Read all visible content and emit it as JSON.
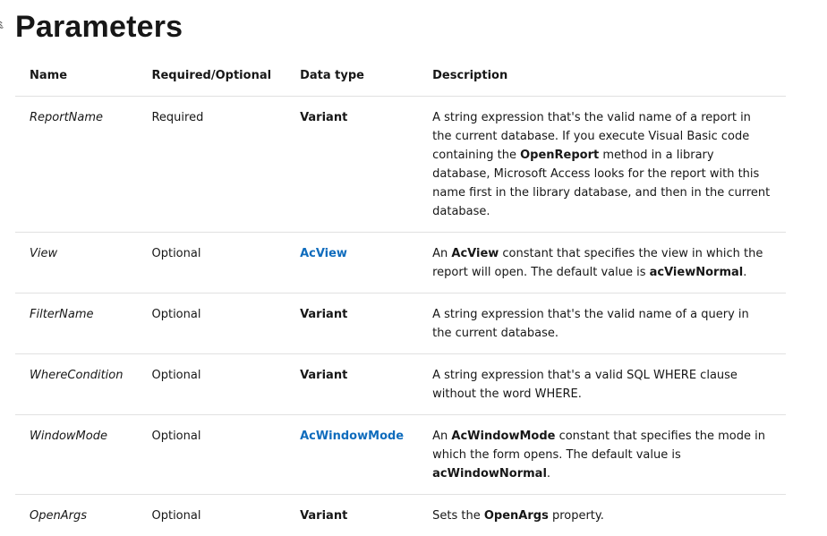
{
  "heading": "Parameters",
  "anchor_icon": "link-icon",
  "columns": {
    "name": "Name",
    "required": "Required/Optional",
    "type": "Data type",
    "description": "Description"
  },
  "rows": [
    {
      "name": "ReportName",
      "required": "Required",
      "type": "Variant",
      "type_is_link": false,
      "description": [
        {
          "t": "A string expression that's the valid name of a report in the current database. If you execute Visual Basic code containing the ",
          "b": false
        },
        {
          "t": "OpenReport",
          "b": true
        },
        {
          "t": " method in a library database, Microsoft Access looks for the report with this name first in the library database, and then in the current database.",
          "b": false
        }
      ]
    },
    {
      "name": "View",
      "required": "Optional",
      "type": "AcView",
      "type_is_link": true,
      "description": [
        {
          "t": "An ",
          "b": false
        },
        {
          "t": "AcView",
          "b": true
        },
        {
          "t": " constant that specifies the view in which the report will open. The default value is ",
          "b": false
        },
        {
          "t": "acViewNormal",
          "b": true
        },
        {
          "t": ".",
          "b": false
        }
      ]
    },
    {
      "name": "FilterName",
      "required": "Optional",
      "type": "Variant",
      "type_is_link": false,
      "description": [
        {
          "t": "A string expression that's the valid name of a query in the current database.",
          "b": false
        }
      ]
    },
    {
      "name": "WhereCondition",
      "required": "Optional",
      "type": "Variant",
      "type_is_link": false,
      "description": [
        {
          "t": "A string expression that's a valid SQL WHERE clause without the word WHERE.",
          "b": false
        }
      ]
    },
    {
      "name": "WindowMode",
      "required": "Optional",
      "type": "AcWindowMode",
      "type_is_link": true,
      "description": [
        {
          "t": "An ",
          "b": false
        },
        {
          "t": "AcWindowMode",
          "b": true
        },
        {
          "t": " constant that specifies the mode in which the form opens. The default value is ",
          "b": false
        },
        {
          "t": "acWindowNormal",
          "b": true
        },
        {
          "t": ".",
          "b": false
        }
      ]
    },
    {
      "name": "OpenArgs",
      "required": "Optional",
      "type": "Variant",
      "type_is_link": false,
      "description": [
        {
          "t": "Sets the ",
          "b": false
        },
        {
          "t": "OpenArgs",
          "b": true
        },
        {
          "t": " property.",
          "b": false
        }
      ]
    }
  ]
}
